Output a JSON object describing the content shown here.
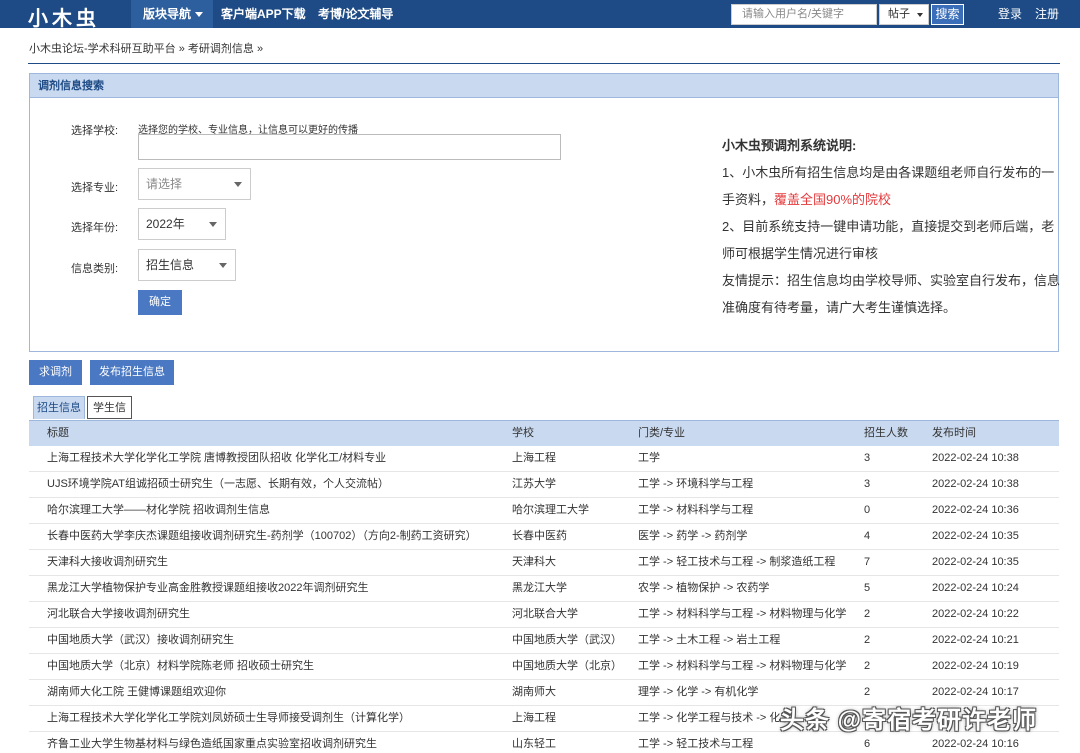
{
  "header": {
    "logo": "小木虫",
    "nav_active": "版块导航",
    "nav_links": [
      "客户端APP下载",
      "考博/论文辅导"
    ],
    "search_placeholder": "请输入用户名/关键字",
    "search_scope": "帖子",
    "search_button": "搜索",
    "login": "登录",
    "register": "注册"
  },
  "breadcrumb": "小木虫论坛-学术科研互助平台 » 考研调剂信息 »",
  "panel": {
    "title": "调剂信息搜索",
    "school_label": "选择学校:",
    "school_hint": "选择您的学校、专业信息，让信息可以更好的传播",
    "major_label": "选择专业:",
    "major_value": "请选择",
    "year_label": "选择年份:",
    "year_value": "2022年",
    "type_label": "信息类别:",
    "type_value": "招生信息",
    "confirm": "确定"
  },
  "description": {
    "title": "小木虫预调剂系统说明:",
    "line1a": "1、小木虫所有招生信息均是由各课题组老师自行发布的一手资料，",
    "line1b": "覆盖全国90%的院校",
    "line2": "2、目前系统支持一键申请功能，直接提交到老师后端，老师可根据学生情况进行审核",
    "line3": "友情提示：招生信息均由学校导师、实验室自行发布，信息准确度有待考量，请广大考生谨慎选择。"
  },
  "actions": {
    "seek": "求调剂",
    "publish": "发布招生信息"
  },
  "tabs": [
    "招生信息",
    "学生信息"
  ],
  "table": {
    "headers": [
      "标题",
      "学校",
      "门类/专业",
      "招生人数",
      "发布时间"
    ],
    "rows": [
      [
        "上海工程技术大学化学化工学院 唐博教授团队招收 化学化工/材料专业",
        "上海工程",
        "工学",
        "3",
        "2022-02-24 10:38"
      ],
      [
        "UJS环境学院AT组诚招硕士研究生（一志愿、长期有效，个人交流帖）",
        "江苏大学",
        "工学 -> 环境科学与工程",
        "3",
        "2022-02-24 10:38"
      ],
      [
        "哈尔滨理工大学——材化学院 招收调剂生信息",
        "哈尔滨理工大学",
        "工学 -> 材料科学与工程",
        "0",
        "2022-02-24 10:36"
      ],
      [
        "长春中医药大学李庆杰课题组接收调剂研究生-药剂学（100702）（方向2-制药工资研究）",
        "长春中医药",
        "医学 -> 药学 -> 药剂学",
        "4",
        "2022-02-24 10:35"
      ],
      [
        "天津科大接收调剂研究生",
        "天津科大",
        "工学 -> 轻工技术与工程 -> 制浆造纸工程",
        "7",
        "2022-02-24 10:35"
      ],
      [
        "黑龙江大学植物保护专业高金胜教授课题组接收2022年调剂研究生",
        "黑龙江大学",
        "农学 -> 植物保护 -> 农药学",
        "5",
        "2022-02-24 10:24"
      ],
      [
        "河北联合大学接收调剂研究生",
        "河北联合大学",
        "工学 -> 材料科学与工程 -> 材料物理与化学",
        "2",
        "2022-02-24 10:22"
      ],
      [
        "中国地质大学（武汉）接收调剂研究生",
        "中国地质大学（武汉）",
        "工学 -> 土木工程 -> 岩土工程",
        "2",
        "2022-02-24 10:21"
      ],
      [
        "中国地质大学（北京）材料学院陈老师 招收硕士研究生",
        "中国地质大学（北京）",
        "工学 -> 材料科学与工程 -> 材料物理与化学",
        "2",
        "2022-02-24 10:19"
      ],
      [
        "湖南师大化工院 王健博课题组欢迎你",
        "湖南师大",
        "理学 -> 化学 -> 有机化学",
        "2",
        "2022-02-24 10:17"
      ],
      [
        "上海工程技术大学化学化工学院刘凤娇硕士生导师接受调剂生（计算化学）",
        "上海工程",
        "工学 -> 化学工程与技术 -> 化学",
        "",
        ""
      ],
      [
        "齐鲁工业大学生物基材料与绿色造纸国家重点实验室招收调剂研究生",
        "山东轻工",
        "工学 -> 轻工技术与工程",
        "6",
        "2022-02-24 10:16"
      ]
    ]
  },
  "watermark": "头条 @寄宿考研许老师"
}
